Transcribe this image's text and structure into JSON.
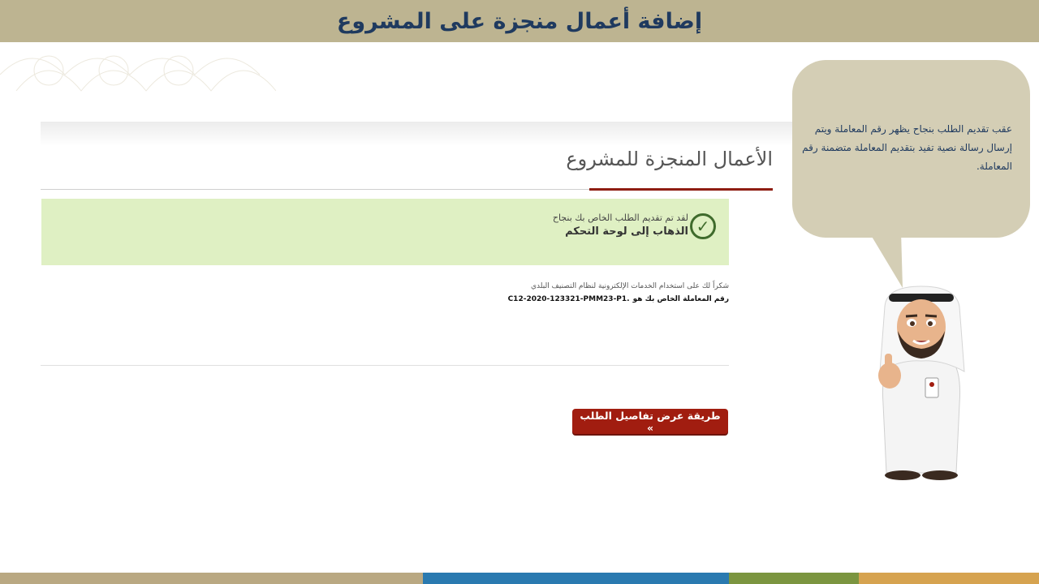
{
  "header": {
    "title": "إضافة أعمال منجزة على المشروع"
  },
  "section": {
    "title": "الأعمال المنجزة للمشروع"
  },
  "success": {
    "message": "لقد تم تقديم الطلب الخاص بك بنجاح",
    "dashboard_link": "الذهاب إلى لوحة التحكم"
  },
  "info": {
    "thanks": "شكراً لك على استخدام الخدمات الإلكترونية لنظام التصنيف البلدي",
    "transaction_label": "رقم المعاملة الخاص بك هو",
    "transaction_number": "C12-2020-123321-PMM23-P1."
  },
  "actions": {
    "details_button": "طريقة عرض تفاصيل الطلب »"
  },
  "callout": {
    "text": "عقب تقديم الطلب بنجاح يظهر رقم المعاملة ويتم إرسال رسالة نصية تفيد بتقديم المعاملة متضمنة رقم المعاملة."
  },
  "colors": {
    "banner": "#bdb491",
    "title_text": "#1f3a5f",
    "accent_red": "#a11d10",
    "success_bg": "#dff0c3",
    "success_icon": "#3f6b2c",
    "bubble": "#d4ceb5",
    "bar_tan": "#b9a882",
    "bar_blue": "#2a7ab0",
    "bar_green": "#7b9540",
    "bar_gold": "#d6a350"
  },
  "icons": {
    "success": "check-circle-icon",
    "mascot": "mascot-character"
  }
}
